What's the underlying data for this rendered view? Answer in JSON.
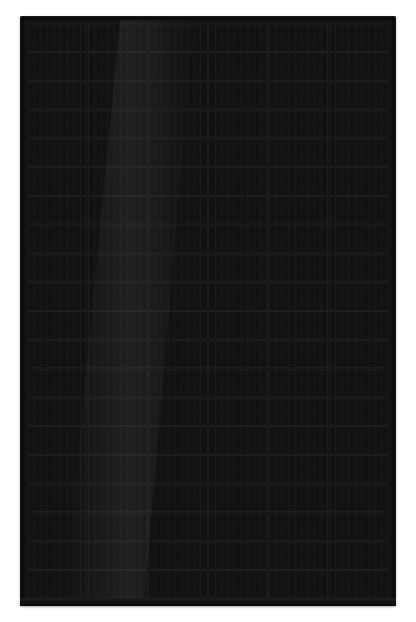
{
  "image": {
    "subject": "solar-panel",
    "colors": {
      "background": "#ffffff",
      "frame": "#0b0b0c",
      "cell": "#121214",
      "busbar": "#3a3a3e",
      "cell_gap": "#2a2a2d",
      "sheen": "#1e1e22"
    },
    "cells": {
      "columns": 6,
      "rows": 20
    }
  }
}
